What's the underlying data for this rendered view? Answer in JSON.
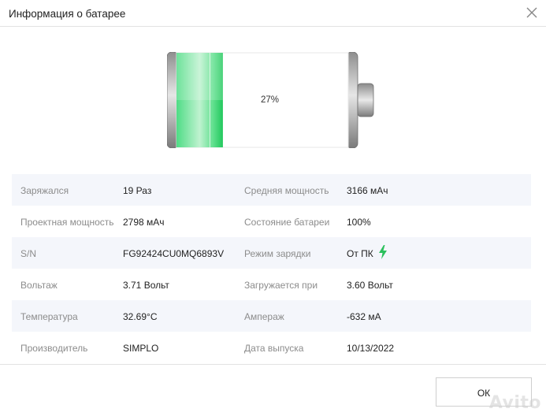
{
  "window": {
    "title": "Информация о батарее",
    "close_label": "×"
  },
  "battery": {
    "level": 0.27,
    "percent_label": "27%",
    "fill_color": "#2fd36a"
  },
  "rows": [
    {
      "label1": "Заряжался",
      "value1": "19 Раз",
      "label2": "Средняя мощность",
      "value2": "3166 мАч"
    },
    {
      "label1": "Проектная мощность",
      "value1": "2798 мАч",
      "label2": "Состояние батареи",
      "value2": "100%"
    },
    {
      "label1": "S/N",
      "value1": "FG92424CU0MQ6893V",
      "label2": "Режим зарядки",
      "value2": "От ПК"
    },
    {
      "label1": "Вольтаж",
      "value1": "3.71 Вольт",
      "label2": "Загружается при",
      "value2": "3.60 Вольт"
    },
    {
      "label1": "Температура",
      "value1": "32.69°C",
      "label2": "Ампераж",
      "value2": "-632 мА"
    },
    {
      "label1": "Производитель",
      "value1": "SIMPLO",
      "label2": "Дата выпуска",
      "value2": "10/13/2022"
    }
  ],
  "charge_mode_icon": "lightning-bolt-icon",
  "footer": {
    "ok_label": "ОК"
  },
  "watermark": "Avito",
  "colors": {
    "row_shade": "#f4f6fb",
    "label": "#8c8c8c",
    "bolt": "#2bc05c"
  }
}
